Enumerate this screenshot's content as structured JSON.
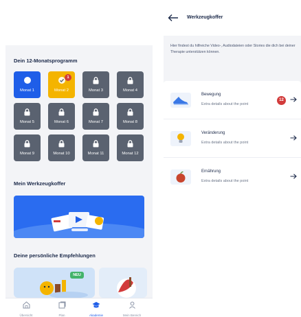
{
  "left": {
    "program_title": "Dein 12-Monatsprogramm",
    "months": [
      {
        "label": "Monat 1",
        "state": "active",
        "icon": "dot-icon"
      },
      {
        "label": "Monat 2",
        "state": "current",
        "icon": "check-badge-icon",
        "badge": "1"
      },
      {
        "label": "Monat 3",
        "state": "locked",
        "icon": "lock-icon"
      },
      {
        "label": "Monat 4",
        "state": "locked",
        "icon": "lock-icon"
      },
      {
        "label": "Monat 5",
        "state": "locked",
        "icon": "lock-icon"
      },
      {
        "label": "Monat 6",
        "state": "locked",
        "icon": "lock-icon"
      },
      {
        "label": "Monat 7",
        "state": "locked",
        "icon": "lock-icon"
      },
      {
        "label": "Monat 8",
        "state": "locked",
        "icon": "lock-icon"
      },
      {
        "label": "Monat 9",
        "state": "locked",
        "icon": "lock-icon"
      },
      {
        "label": "Monat 10",
        "state": "locked",
        "icon": "lock-icon"
      },
      {
        "label": "Monat 11",
        "state": "locked",
        "icon": "lock-icon"
      },
      {
        "label": "Monat 12",
        "state": "locked",
        "icon": "lock-icon"
      }
    ],
    "toolbox_title": "Mein Werkzeugkoffer",
    "recommend_title": "Deine persönliche Empfehlungen",
    "new_badge": "NEU",
    "tabs": [
      {
        "label": "Übersicht",
        "icon": "home-icon"
      },
      {
        "label": "Plan",
        "icon": "plan-icon"
      },
      {
        "label": "Akademie",
        "icon": "academy-icon",
        "active": true
      },
      {
        "label": "Mein Bereich",
        "icon": "user-icon"
      }
    ]
  },
  "right": {
    "title": "Werkzeugkoffer",
    "intro": "Hier findest du hilfreiche Video-, Audiodateien oder Stories die dich bei deiner Therapie unterstützen können.",
    "items": [
      {
        "name": "Bewegung",
        "sub": "Extra details about the point",
        "icon": "shoe-icon",
        "count": "12"
      },
      {
        "name": "Veränderung",
        "sub": "Extra details about the point",
        "icon": "lightbulb-icon"
      },
      {
        "name": "Ernährung",
        "sub": "Extra details about the point",
        "icon": "apple-icon"
      }
    ]
  },
  "colors": {
    "primary": "#1f5ee8",
    "current": "#f4b400",
    "locked": "#5a6270",
    "badge": "#d23b3b",
    "new": "#44b36a"
  }
}
